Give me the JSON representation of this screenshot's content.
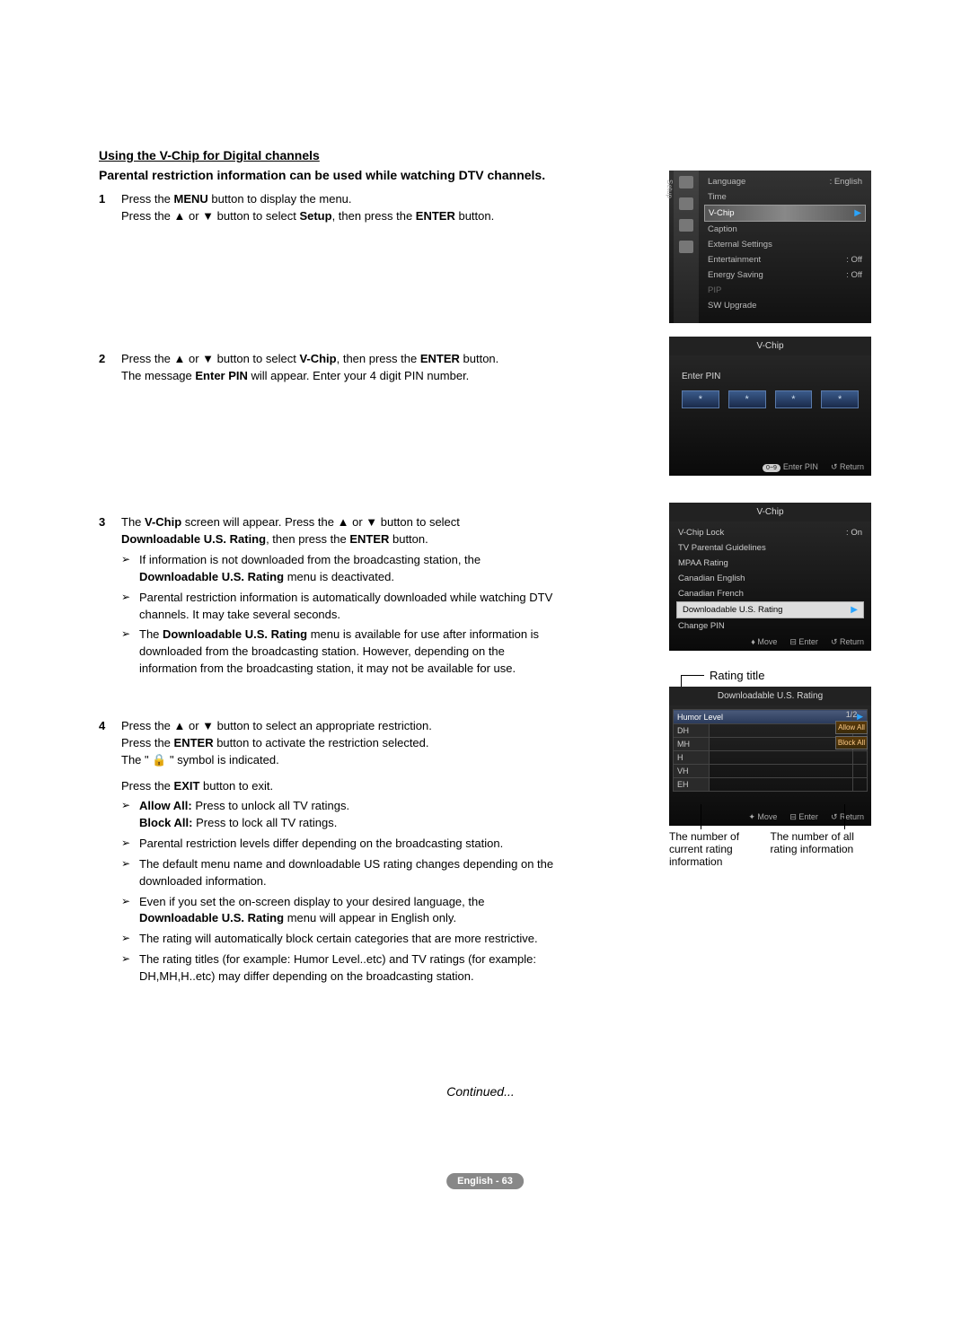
{
  "heading": "Using the V-Chip for Digital channels",
  "subheading": "Parental restriction information can be used while watching DTV channels.",
  "steps": {
    "s1": {
      "num": "1",
      "l1a": "Press the ",
      "l1b": "MENU",
      "l1c": " button to display the menu.",
      "l2a": "Press the ▲ or ▼ button to select ",
      "l2b": "Setup",
      "l2c": ", then press the ",
      "l2d": "ENTER",
      "l2e": " button."
    },
    "s2": {
      "num": "2",
      "l1a": "Press the ▲ or ▼ button to select ",
      "l1b": "V-Chip",
      "l1c": ", then press the ",
      "l1d": "ENTER",
      "l1e": " button.",
      "l2a": "The message ",
      "l2b": "Enter PIN",
      "l2c": " will appear. Enter your 4 digit PIN number."
    },
    "s3": {
      "num": "3",
      "l1a": "The ",
      "l1b": "V-Chip",
      "l1c": " screen will appear. Press the ▲ or ▼ button to select ",
      "l2a": "Downloadable U.S. Rating",
      "l2b": ", then press the ",
      "l2c": "ENTER",
      "l2d": " button.",
      "notes": {
        "n1a": "If information is not downloaded from the broadcasting station, the ",
        "n1b": "Downloadable U.S. Rating",
        "n1c": " menu is deactivated.",
        "n2": "Parental restriction information is automatically downloaded while watching DTV channels. It may take several seconds.",
        "n3a": "The ",
        "n3b": "Downloadable U.S. Rating",
        "n3c": " menu is available for use after information is downloaded from the broadcasting station. However, depending on the information from the broadcasting station, it may not be available for use."
      }
    },
    "s4": {
      "num": "4",
      "l1": "Press the ▲ or ▼ button to select an appropriate restriction.",
      "l2a": "Press the ",
      "l2b": "ENTER",
      "l2c": " button to activate the restriction selected.",
      "l3": "The \" 🔒 \" symbol is indicated.",
      "l4a": "Press the ",
      "l4b": "EXIT",
      "l4c": " button to exit.",
      "notes": {
        "n1a": "Allow All:",
        "n1b": " Press to unlock all TV ratings.",
        "n1c": "Block All:",
        "n1d": " Press to lock all TV ratings.",
        "n2": "Parental restriction levels differ depending on the broadcasting station.",
        "n3": "The default menu name and downloadable US rating changes depending on the downloaded information.",
        "n4a": "Even if you set the on-screen display to your desired language, the ",
        "n4b": "Downloadable U.S. Rating",
        "n4c": " menu will appear in English only.",
        "n5": "The rating will automatically block certain categories that are more restrictive.",
        "n6": "The rating titles (for example: Humor Level..etc) and TV ratings (for example: DH,MH,H..etc) may differ depending on the broadcasting station."
      }
    }
  },
  "continued": "Continued...",
  "footer": "English - 63",
  "tv1": {
    "sidebar": "Setup",
    "rows": [
      {
        "label": "Language",
        "value": ": English"
      },
      {
        "label": "Time",
        "value": ""
      },
      {
        "label": "V-Chip",
        "value": "",
        "sel": true
      },
      {
        "label": "Caption",
        "value": ""
      },
      {
        "label": "External Settings",
        "value": ""
      },
      {
        "label": "Entertainment",
        "value": ": Off"
      },
      {
        "label": "Energy Saving",
        "value": ": Off"
      },
      {
        "label": "PIP",
        "value": "",
        "dim": true
      },
      {
        "label": "SW Upgrade",
        "value": ""
      }
    ]
  },
  "tv2": {
    "title": "V-Chip",
    "label": "Enter PIN",
    "dots": [
      "*",
      "*",
      "*",
      "*"
    ],
    "foot1": "Enter PIN",
    "foot1btn": "0~9",
    "foot2": "Return"
  },
  "tv3": {
    "title": "V-Chip",
    "rows": [
      {
        "label": "V-Chip Lock",
        "value": ": On"
      },
      {
        "label": "TV Parental Guidelines",
        "value": ""
      },
      {
        "label": "MPAA Rating",
        "value": ""
      },
      {
        "label": "Canadian English",
        "value": ""
      },
      {
        "label": "Canadian French",
        "value": ""
      },
      {
        "label": "Downloadable U.S. Rating",
        "value": "",
        "sel": true
      },
      {
        "label": "Change PIN",
        "value": ""
      }
    ],
    "foot1": "Move",
    "foot2": "Enter",
    "foot3": "Return"
  },
  "rating_title_label": "Rating title",
  "tv4": {
    "title": "Downloadable U.S. Rating",
    "header": "Humor Level",
    "rows": [
      "DH",
      "MH",
      "H",
      "VH",
      "EH"
    ],
    "frac": "1/2",
    "allow": "Allow All",
    "block": "Block All",
    "foot1": "Move",
    "foot2": "Enter",
    "foot3": "Return"
  },
  "captions": {
    "left": "The number of current rating information",
    "right": "The number of all rating information"
  }
}
